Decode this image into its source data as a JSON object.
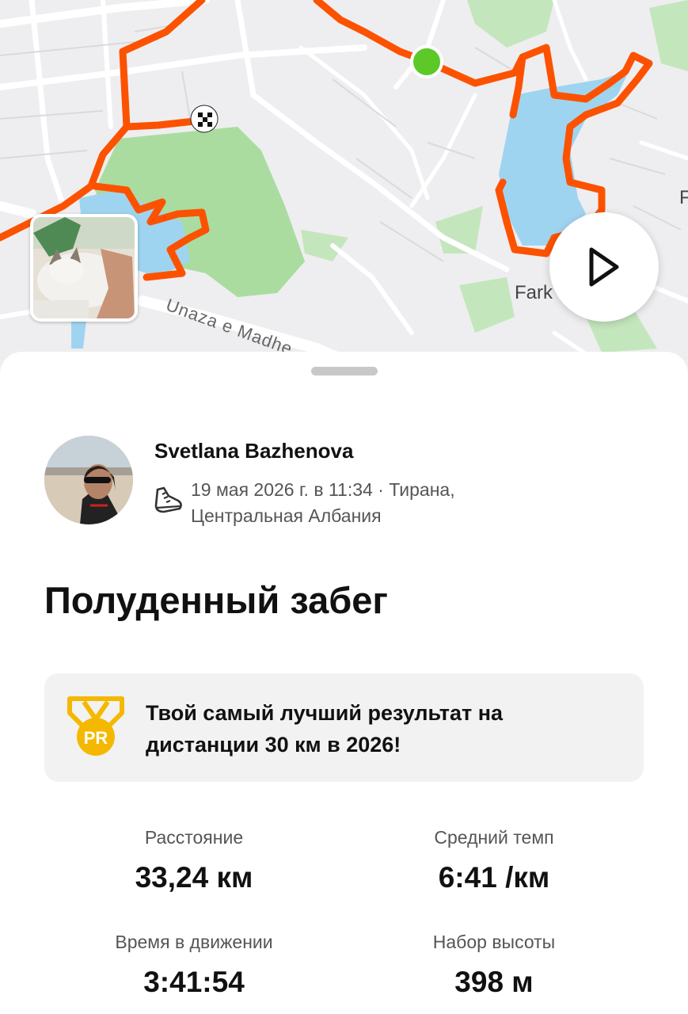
{
  "map": {
    "street_label": "Unaza e Madhe",
    "place_label": "Fark",
    "edge_label": "F",
    "route_color": "#fc5200",
    "start_marker_color": "#5cc928",
    "park_color": "#a9dca0",
    "water_color": "#9fd4f0"
  },
  "map_controls": {
    "play_icon": "play-icon"
  },
  "athlete": {
    "name": "Svetlana Bazhenova",
    "sport_icon": "running-shoe-icon",
    "meta": "19 мая 2026 г. в 11:34 · Тирана, Центральная Албания"
  },
  "activity": {
    "title": "Полуденный забег"
  },
  "achievement": {
    "icon": "pr-medal-icon",
    "icon_text": "PR",
    "icon_color": "#f5b800",
    "text": "Твой самый лучший результат на дистанции 30 км в 2026!"
  },
  "stats": [
    {
      "label": "Расстояние",
      "value": "33,24 км"
    },
    {
      "label": "Средний темп",
      "value": "6:41 /км"
    },
    {
      "label": "Время в движении",
      "value": "3:41:54"
    },
    {
      "label": "Набор высоты",
      "value": "398 м"
    }
  ]
}
